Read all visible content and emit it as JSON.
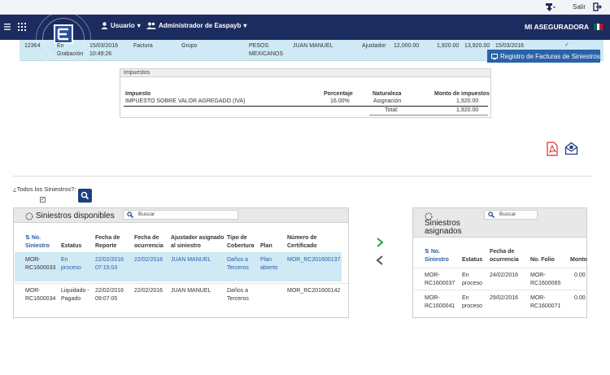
{
  "topbar": {
    "salir": "Salir"
  },
  "navbar": {
    "usuario": "Usuario",
    "admin": "Administrador de Easpayb",
    "brand": "MI ASEGURADORA"
  },
  "invoice_row": {
    "id": "12364",
    "estatus": "En Grabación",
    "fecha": "15/03/2016 10:49:26",
    "tipo": "Factura",
    "grupo": "Grupo",
    "moneda": "PESOS MEXICANOS",
    "nombre": "JUAN MANUEL",
    "rol": "Ajustador",
    "monto1": "12,000.00",
    "monto2": "1,920.00",
    "monto3": "13,920.00",
    "fecha2": "15/03/2016"
  },
  "register_button": "Registro de Facturas de Siniestros",
  "impuestos": {
    "title": "Impuestos",
    "headers": {
      "impuesto": "Impuesto",
      "porcentaje": "Porcentaje",
      "naturaleza": "Naturaleza",
      "monto": "Monto de impuestos"
    },
    "row": {
      "impuesto": "IMPUESTO SOBRE VALOR AGREGADO (IVA)",
      "porcentaje": "16.00%",
      "naturaleza": "Asignación",
      "monto": "1,920.00"
    },
    "total_label": "Total:",
    "total_value": "1,920.00"
  },
  "filter": {
    "label": "¿Todos los Siniestros?:",
    "checked": "✓"
  },
  "disponibles": {
    "title": "Siniestros disponibles",
    "search_placeholder": "Buscar",
    "headers": {
      "no": "No. Siniestro",
      "estatus": "Estatus",
      "fecha_reporte": "Fecha de Reporte",
      "fecha_ocurrencia": "Fecha de ocurrencia",
      "ajustador": "Ajustador asignado al siniestro",
      "tipo": "Tipo de Cobertura",
      "plan": "Plan",
      "certificado": "Número de Certificado"
    },
    "rows": [
      {
        "no": "MOR-RC1600033",
        "estatus": "En proceso",
        "fecha_reporte": "22/02/2016 07:15:03",
        "fecha_ocurrencia": "22/02/2016",
        "ajustador": "JUAN MANUEL",
        "tipo": "Daños a Terceros",
        "plan": "Plan abierto",
        "certificado": "MOR_RC201600137"
      },
      {
        "no": "MOR-RC1600034",
        "estatus": "Liquidado - Pagado",
        "fecha_reporte": "22/02/2016 09:07:05",
        "fecha_ocurrencia": "22/02/2016",
        "ajustador": "JUAN MANUEL",
        "tipo": "Daños a Terceros",
        "plan": "",
        "certificado": "MOR_RC201600142"
      }
    ]
  },
  "asignados": {
    "title": "Siniestros asignados",
    "search_placeholder": "Buscar",
    "headers": {
      "no": "No. Siniestro",
      "estatus": "Estatus",
      "fecha_ocurrencia": "Fecha de ocurrencia",
      "folio": "No. Folio",
      "monto": "Monto"
    },
    "rows": [
      {
        "no": "MOR-RC1600037",
        "estatus": "En proceso",
        "fecha_ocurrencia": "24/02/2016",
        "folio": "MOR-RC1600065",
        "monto": "0.00"
      },
      {
        "no": "MOR-RC1600041",
        "estatus": "En proceso",
        "fecha_ocurrencia": "29/02/2016",
        "folio": "MOR-RC1600071",
        "monto": "0.00"
      }
    ]
  }
}
